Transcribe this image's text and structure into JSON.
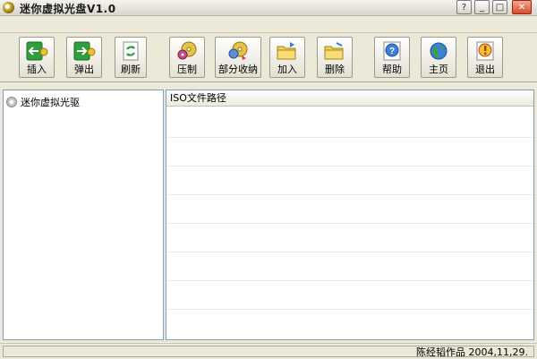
{
  "window": {
    "title": "迷你虚拟光盘V1.0",
    "controls": {
      "help": "?",
      "minimize": "_",
      "maximize": "□",
      "close": "✕"
    }
  },
  "toolbar": {
    "buttons": [
      {
        "label": "插入",
        "icon": "insert-arrow-left-icon"
      },
      {
        "label": "弹出",
        "icon": "eject-arrow-right-icon"
      },
      {
        "label": "刷新",
        "icon": "refresh-icon"
      },
      {
        "label": "压制",
        "icon": "burn-disc-icon"
      },
      {
        "label": "部分收纳",
        "icon": "partial-collect-icon"
      },
      {
        "label": "加入",
        "icon": "add-folder-icon"
      },
      {
        "label": "删除",
        "icon": "delete-folder-icon"
      },
      {
        "label": "帮助",
        "icon": "help-icon"
      },
      {
        "label": "主页",
        "icon": "homepage-globe-icon"
      },
      {
        "label": "退出",
        "icon": "exit-icon"
      }
    ]
  },
  "tree": {
    "root_label": "迷你虚拟光驱"
  },
  "list": {
    "column_header": "ISO文件路径"
  },
  "status": {
    "author": "陈经韬作品",
    "date": "2004,11,29."
  }
}
